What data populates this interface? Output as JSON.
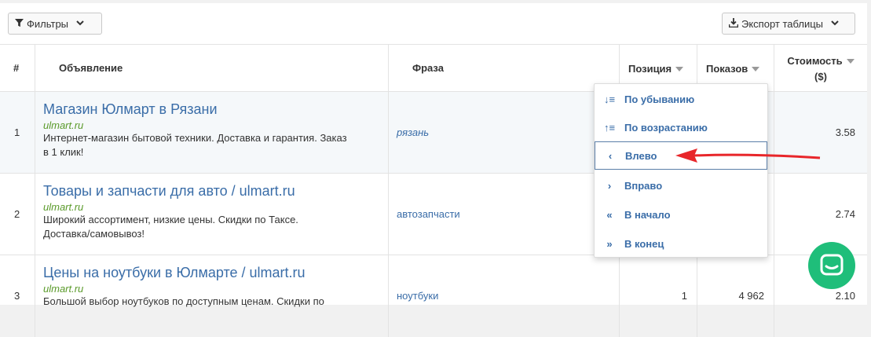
{
  "toolbar": {
    "filters_label": "Фильтры",
    "export_label": "Экспорт таблицы"
  },
  "columns": {
    "num": "#",
    "ad": "Объявление",
    "phrase": "Фраза",
    "position": "Позиция",
    "shows": "Показов",
    "cost_line1": "Стоимость",
    "cost_line2": "($)"
  },
  "rows": [
    {
      "num": "1",
      "title": "Магазин Юлмарт в Рязани",
      "url": "ulmart.ru",
      "desc_line1": "Интернет-магазин бытовой техники. Доставка и гарантия. Заказ",
      "desc_line2": "в 1 клик!",
      "phrase": "рязань",
      "position": "",
      "shows": "",
      "cost": "3.58"
    },
    {
      "num": "2",
      "title": "Товары и запчасти для авто / ulmart.ru",
      "url": "ulmart.ru",
      "desc_line1": "Широкий ассортимент, низкие цены. Скидки по Таксе.",
      "desc_line2": "Доставка/самовывоз!",
      "phrase": "автозапчасти",
      "position": "",
      "shows": "",
      "cost": "2.74"
    },
    {
      "num": "3",
      "title": "Цены на ноутбуки в Юлмарте / ulmart.ru",
      "url": "ulmart.ru",
      "desc_line1": "Большой выбор ноутбуков по доступным ценам. Скидки по",
      "desc_line2": "",
      "phrase": "ноутбуки",
      "position": "1",
      "shows": "4 962",
      "cost": "2.10"
    }
  ],
  "menu": {
    "items": [
      {
        "icon": "sort-desc-icon",
        "glyph": "↓≡",
        "label": "По убыванию"
      },
      {
        "icon": "sort-asc-icon",
        "glyph": "↑≡",
        "label": "По возрастанию"
      },
      {
        "icon": "chevron-left-icon",
        "glyph": "‹",
        "label": "Влево"
      },
      {
        "icon": "chevron-right-icon",
        "glyph": "›",
        "label": "Вправо"
      },
      {
        "icon": "double-chevron-left-icon",
        "glyph": "«",
        "label": "В начало"
      },
      {
        "icon": "double-chevron-right-icon",
        "glyph": "»",
        "label": "В конец"
      }
    ]
  },
  "colors": {
    "link": "#3a6da8",
    "url_green": "#5a9a2a",
    "arrow_red": "#e8262a",
    "chat_green": "#1fbe7a"
  }
}
